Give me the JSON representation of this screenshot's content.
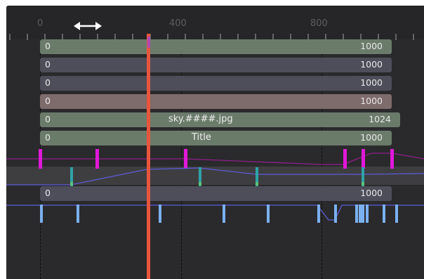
{
  "ruler": {
    "tick_labels": [
      "0",
      "400",
      "800"
    ],
    "resize_icon": "double-arrow-horizontal-icon"
  },
  "tracks": [
    {
      "start": "0",
      "end": "1000",
      "name": "",
      "color": "#6b7b6a"
    },
    {
      "start": "0",
      "end": "1000",
      "name": "",
      "color": "#4d4e5a"
    },
    {
      "start": "0",
      "end": "1000",
      "name": "",
      "color": "#4d4e5a"
    },
    {
      "start": "0",
      "end": "1000",
      "name": "",
      "color": "#7e6b6b"
    },
    {
      "start": "0",
      "end": "1024",
      "name": "sky.####.jpg",
      "color": "#6b7b6a"
    },
    {
      "start": "0",
      "end": "1000",
      "name": "Title",
      "color": "#6b7b6a"
    },
    {
      "start": "0",
      "end": "1000",
      "name": "",
      "color": "#4d4e5a"
    }
  ],
  "colors": {
    "playhead": "#e8553d",
    "magenta_keys": "#e018d8",
    "teal_keys": "#2fa3a6",
    "blue_keys": "#7ab0f0",
    "purple_curve": "#8e1f8a",
    "blue_curve": "#5d5ad8"
  }
}
